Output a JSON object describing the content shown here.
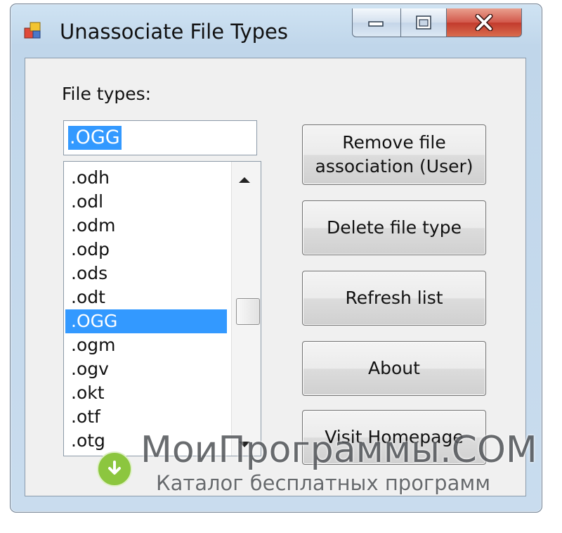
{
  "window": {
    "title": "Unassociate File Types"
  },
  "form": {
    "file_types_label": "File types:",
    "input_value": ".OGG",
    "list_items": [
      {
        "label": ".odh",
        "selected": false
      },
      {
        "label": ".odl",
        "selected": false
      },
      {
        "label": ".odm",
        "selected": false
      },
      {
        "label": ".odp",
        "selected": false
      },
      {
        "label": ".ods",
        "selected": false
      },
      {
        "label": ".odt",
        "selected": false
      },
      {
        "label": ".OGG",
        "selected": true
      },
      {
        "label": ".ogm",
        "selected": false
      },
      {
        "label": ".ogv",
        "selected": false
      },
      {
        "label": ".okt",
        "selected": false
      },
      {
        "label": ".otf",
        "selected": false
      },
      {
        "label": ".otg",
        "selected": false
      }
    ]
  },
  "buttons": {
    "remove_line1": "Remove file",
    "remove_line2": "association (User)",
    "delete": "Delete file type",
    "refresh": "Refresh list",
    "about": "About",
    "visit": "Visit Homepage"
  },
  "watermark": {
    "title": "МоиПрограммы.COM",
    "subtitle": "Каталог бесплатных программ"
  },
  "colors": {
    "selection": "#3399ff",
    "close_button": "#c9453a",
    "watermark_circle": "#8cc63f"
  },
  "icons": {
    "app": "app-icon",
    "minimize": "minimize-icon",
    "maximize": "maximize-icon",
    "close": "close-icon",
    "watermark": "download-arrow-icon"
  }
}
